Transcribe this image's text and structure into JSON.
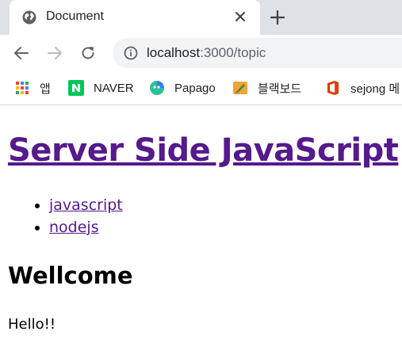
{
  "browser": {
    "tab": {
      "title": "Document"
    },
    "address": {
      "host": "localhost",
      "path": ":3000/topic"
    },
    "bookmarks": [
      {
        "label": "앱",
        "icon": "apps-grid-icon"
      },
      {
        "label": "NAVER",
        "icon": "naver-icon"
      },
      {
        "label": "Papago",
        "icon": "papago-icon"
      },
      {
        "label": "블랙보드",
        "icon": "blackboard-icon"
      },
      {
        "label": "sejong 메",
        "icon": "office-icon"
      }
    ]
  },
  "page": {
    "title": "Server Side JavaScript",
    "topics": [
      "javascript",
      "nodejs"
    ],
    "heading": "Wellcome",
    "body": "Hello!!"
  },
  "colors": {
    "visited_link": "#551a8b",
    "tabstrip": "#dee1e6",
    "omnibox": "#f1f3f4"
  }
}
